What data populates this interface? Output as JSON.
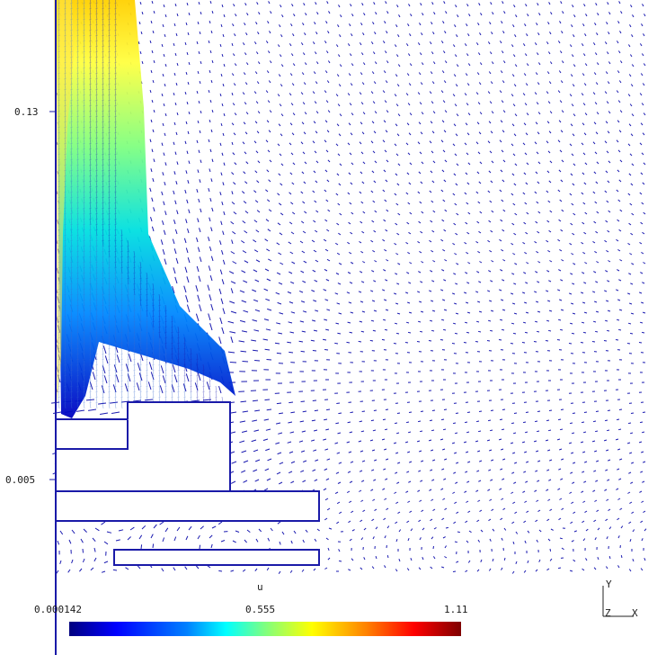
{
  "axes": {
    "y_ticks": [
      "0.13",
      "0.005"
    ]
  },
  "colorbar": {
    "variable": "u",
    "min_label": "0.000142",
    "mid_label": "0.555",
    "max_label": "1.11",
    "colormap": "jet"
  },
  "triad": {
    "y_label": "Y",
    "z_label": "Z",
    "x_label": "X"
  },
  "colors": {
    "geometry_outline": "#1a1aa8",
    "background": "#ffffff",
    "slow_vector": "#1a1ab0"
  }
}
